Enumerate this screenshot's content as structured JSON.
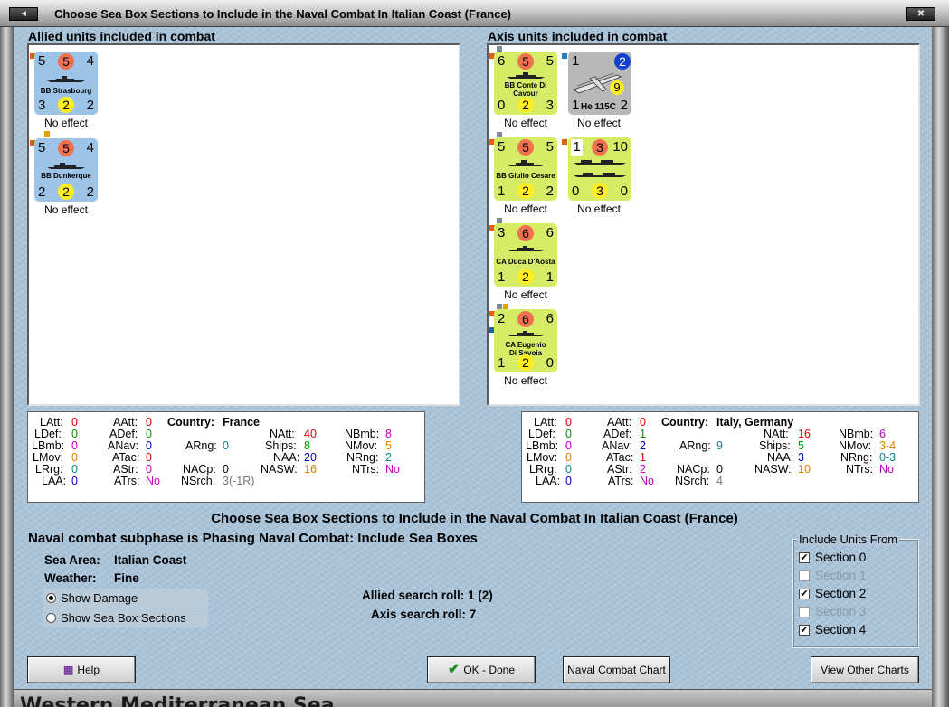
{
  "window": {
    "title": "Choose Sea Box Sections to Include in the Naval Combat In Italian Coast (France)"
  },
  "allied": {
    "heading": "Allied units included in combat",
    "units": [
      {
        "tl": "5",
        "tc": "5",
        "tr": "4",
        "name": "BB Strasbourg",
        "bl": "3",
        "bc": "2",
        "br": "2",
        "effect": "No effect"
      },
      {
        "tl": "5",
        "tc": "5",
        "tr": "4",
        "name": "BB Dunkerque",
        "bl": "2",
        "bc": "2",
        "br": "2",
        "effect": "No effect"
      }
    ]
  },
  "axis": {
    "heading": "Axis units included in combat",
    "units": [
      {
        "tl": "6",
        "tc": "5",
        "tr": "5",
        "name": "BB Conte Di Cavour",
        "bl": "0",
        "bc": "2",
        "br": "3",
        "effect": "No effect"
      },
      {
        "tl": "1",
        "tc": "2",
        "tr": "",
        "mid": "9",
        "name": "He 115C",
        "bl": "1",
        "bc": "",
        "br": "2",
        "effect": "No effect"
      },
      {
        "tl": "5",
        "tc": "5",
        "tr": "5",
        "name": "BB Giulio Cesare",
        "bl": "1",
        "bc": "2",
        "br": "2",
        "effect": "No effect"
      },
      {
        "tl": "1",
        "tc": "3",
        "tr": "10",
        "name": "",
        "bl": "0",
        "bc": "3",
        "br": "0",
        "effect": "No effect"
      },
      {
        "tl": "3",
        "tc": "6",
        "tr": "6",
        "name": "CA Duca D'Aosta",
        "bl": "1",
        "bc": "2",
        "br": "1",
        "effect": "No effect"
      },
      {
        "tl": "2",
        "tc": "6",
        "tr": "6",
        "name": "CA Eugenio Di Savoia",
        "bl": "1",
        "bc": "2",
        "br": "0",
        "effect": "No effect"
      }
    ]
  },
  "allied_stats": {
    "latt": "LAtt:",
    "latt_v": "0",
    "aatt": "AAtt:",
    "aatt_v": "0",
    "country_l": "Country:",
    "country": "France",
    "ldef": "LDef:",
    "ldef_v": "0",
    "adef": "ADef:",
    "adef_v": "0",
    "natt": "NAtt:",
    "natt_v": "40",
    "nbmb": "NBmb:",
    "nbmb_v": "8",
    "lbmb": "LBmb:",
    "lbmb_v": "0",
    "anav": "ANav:",
    "anav_v": "0",
    "arng": "ARng:",
    "arng_v": "0",
    "ships": "Ships:",
    "ships_v": "8",
    "nmov": "NMov:",
    "nmov_v": "5",
    "lmov": "LMov:",
    "lmov_v": "0",
    "atac": "ATac:",
    "atac_v": "0",
    "naa": "NAA:",
    "naa_v": "20",
    "nrng": "NRng:",
    "nrng_v": "2",
    "lrrg": "LRrg:",
    "lrrg_v": "0",
    "astr": "AStr:",
    "astr_v": "0",
    "nacp": "NACp:",
    "nacp_v": "0",
    "nasw": "NASW:",
    "nasw_v": "16",
    "ntrs": "NTrs:",
    "ntrs_v": "No",
    "laa": "LAA:",
    "laa_v": "0",
    "atrs": "ATrs:",
    "atrs_v": "No",
    "nsrch": "NSrch:",
    "nsrch_v": "3(-1R)"
  },
  "axis_stats": {
    "latt": "LAtt:",
    "latt_v": "0",
    "aatt": "AAtt:",
    "aatt_v": "0",
    "country_l": "Country:",
    "country": "Italy, Germany",
    "ldef": "LDef:",
    "ldef_v": "0",
    "adef": "ADef:",
    "adef_v": "1",
    "natt": "NAtt:",
    "natt_v": "16",
    "nbmb": "NBmb:",
    "nbmb_v": "6",
    "lbmb": "LBmb:",
    "lbmb_v": "0",
    "anav": "ANav:",
    "anav_v": "2",
    "arng": "ARng:",
    "arng_v": "9",
    "ships": "Ships:",
    "ships_v": "5",
    "nmov": "NMov:",
    "nmov_v": "3-4",
    "lmov": "LMov:",
    "lmov_v": "0",
    "atac": "ATac:",
    "atac_v": "1",
    "naa": "NAA:",
    "naa_v": "3",
    "nrng": "NRng:",
    "nrng_v": "0-3",
    "lrrg": "LRrg:",
    "lrrg_v": "0",
    "astr": "AStr:",
    "astr_v": "2",
    "nacp": "NACp:",
    "nacp_v": "0",
    "nasw": "NASW:",
    "nasw_v": "10",
    "ntrs": "NTrs:",
    "ntrs_v": "No",
    "laa": "LAA:",
    "laa_v": "0",
    "atrs": "ATrs:",
    "atrs_v": "No",
    "nsrch": "NSrch:",
    "nsrch_v": "4"
  },
  "main": {
    "title": "Choose Sea Box Sections to Include in the Naval Combat In Italian Coast (France)",
    "subphase": "Naval combat subphase is Phasing Naval Combat: Include Sea Boxes",
    "sea_area_label": "Sea Area:",
    "sea_area": "Italian Coast",
    "weather_label": "Weather:",
    "weather": "Fine",
    "show_damage": "Show Damage",
    "show_sections": "Show Sea Box Sections",
    "allied_roll": "Allied search roll: 1 (2)",
    "axis_roll": "Axis search roll: 7"
  },
  "include": {
    "legend": "Include Units From",
    "sections": [
      {
        "label": "Section 0",
        "checked": true,
        "enabled": true
      },
      {
        "label": "Section 1",
        "checked": false,
        "enabled": false
      },
      {
        "label": "Section 2",
        "checked": true,
        "enabled": true
      },
      {
        "label": "Section 3",
        "checked": false,
        "enabled": false
      },
      {
        "label": "Section 4",
        "checked": true,
        "enabled": true
      }
    ]
  },
  "buttons": {
    "help": "Help",
    "ok": "OK - Done",
    "naval_chart": "Naval Combat Chart",
    "view_other": "View Other Charts"
  },
  "background": {
    "map_text": "Western Mediterranean Sea"
  },
  "colors": {
    "allied_counter": "#9dc4e6",
    "axis_counter": "#d6ec66",
    "attack_circle": "#f07050",
    "defense_circle": "#ffee22"
  }
}
